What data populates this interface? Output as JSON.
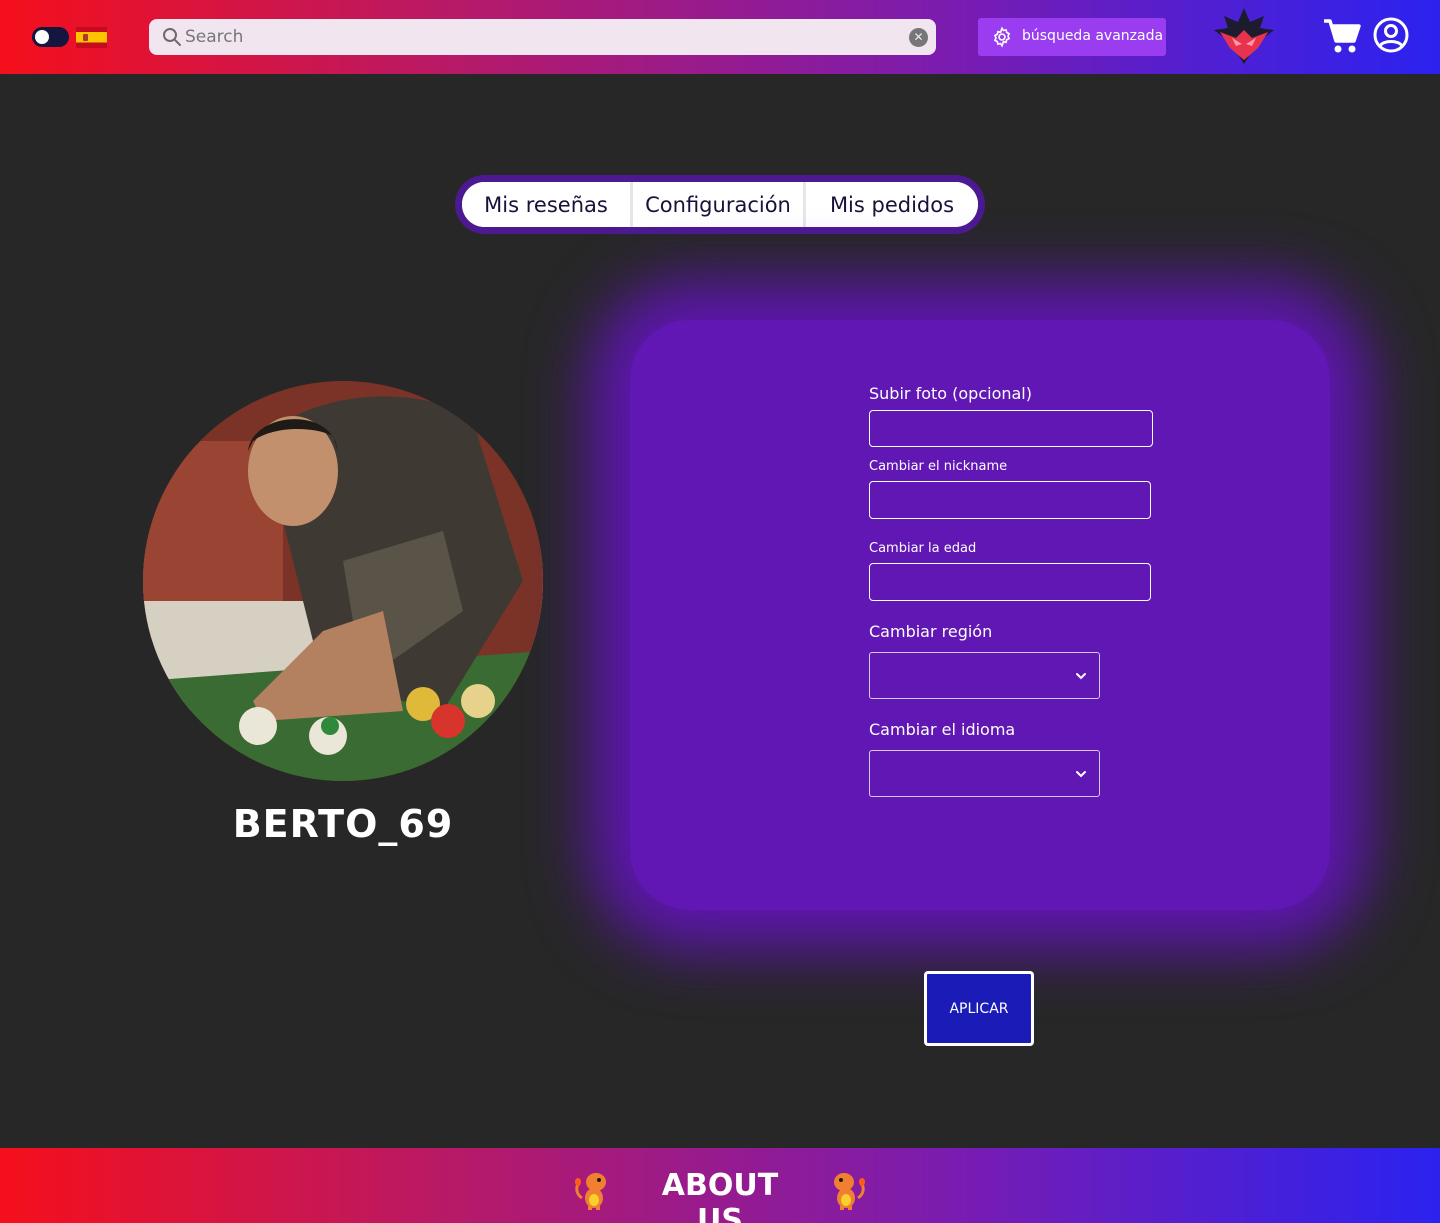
{
  "header": {
    "search_placeholder": "Search",
    "advanced_search_label": "búsqueda avanzada",
    "theme_toggle": "dark-mode",
    "language_flag": "es"
  },
  "tabs": [
    {
      "label": "Mis reseñas"
    },
    {
      "label": "Configuración"
    },
    {
      "label": "Mis pedidos"
    }
  ],
  "profile": {
    "nickname": "BERTO_69"
  },
  "form": {
    "photo_label": "Subir foto (opcional)",
    "nickname_label": "Cambiar el nickname",
    "age_label": "Cambiar la edad",
    "region_label": "Cambiar región",
    "language_label": "Cambiar el idioma",
    "photo_value": "",
    "nickname_value": "",
    "age_value": "",
    "apply_label": "APLICAR"
  },
  "footer": {
    "about_label": "ABOUT US"
  },
  "colors": {
    "background": "#272727",
    "gradient_start": "#f50f1c",
    "gradient_end": "#2b22f0",
    "panel": "#6117b4",
    "apply_button": "#1b1cb8",
    "tabs_border": "#4b1a90"
  }
}
